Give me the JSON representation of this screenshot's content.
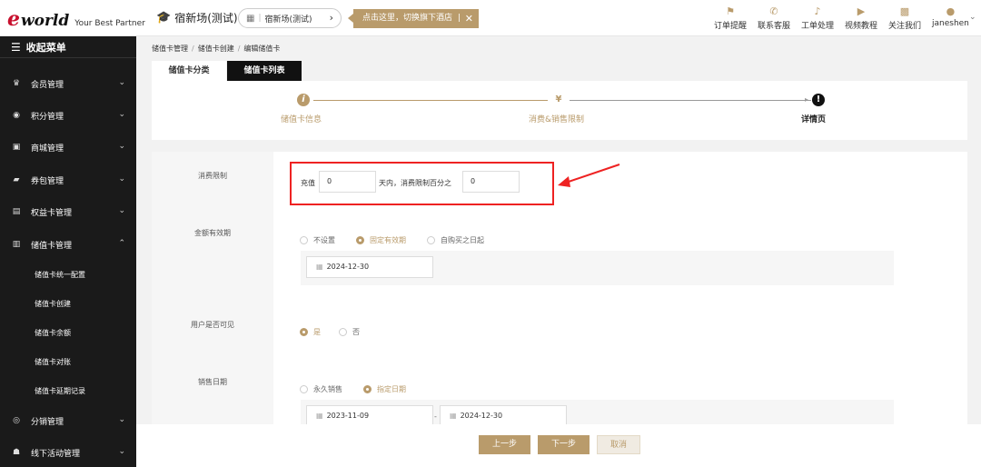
{
  "header": {
    "logo_e": "e",
    "logo_word": "world",
    "logo_tagline": "Your Best Partner",
    "hotel_name": "宿新场(测试)",
    "hotel_selector": "宿新场(测试)",
    "switch_tip": "点击这里，切换旗下酒店",
    "nav": [
      {
        "label": "订单提醒",
        "icon": "bell-ringing-icon"
      },
      {
        "label": "联系客服",
        "icon": "phone-icon"
      },
      {
        "label": "工单处理",
        "icon": "bell-icon"
      },
      {
        "label": "视频教程",
        "icon": "video-icon"
      },
      {
        "label": "关注我们",
        "icon": "qrcode-icon"
      },
      {
        "label": "janeshen",
        "icon": "user-icon"
      }
    ]
  },
  "sidebar": {
    "collapse_label": "收起菜单",
    "items": [
      {
        "label": "会员管理",
        "icon": "crown-icon"
      },
      {
        "label": "积分管理",
        "icon": "coins-icon"
      },
      {
        "label": "商城管理",
        "icon": "shop-icon"
      },
      {
        "label": "券包管理",
        "icon": "ticket-icon"
      },
      {
        "label": "权益卡管理",
        "icon": "card-icon"
      },
      {
        "label": "储值卡管理",
        "icon": "wallet-icon"
      }
    ],
    "subitems": [
      "储值卡统一配置",
      "储值卡创建",
      "储值卡余额",
      "储值卡对账",
      "储值卡延期记录"
    ],
    "items_after": [
      {
        "label": "分销管理",
        "icon": "share-icon"
      },
      {
        "label": "线下活动管理",
        "icon": "people-icon"
      }
    ]
  },
  "breadcrumb": [
    "储值卡管理",
    "储值卡创建",
    "编辑储值卡"
  ],
  "tabs": [
    "储值卡分类",
    "储值卡列表"
  ],
  "steps": [
    {
      "label": "储值卡信息",
      "icon": "i"
    },
    {
      "label": "消费&销售限制",
      "icon": "¥"
    },
    {
      "label": "详情页",
      "icon": "!"
    }
  ],
  "form": {
    "consume_limit": {
      "label": "消费限制",
      "prefix": "充值",
      "days_value": "0",
      "middle": "天内，消费限制百分之",
      "percent_value": "0"
    },
    "validity": {
      "label": "金额有效期",
      "options": [
        "不设置",
        "固定有效期",
        "自购买之日起"
      ],
      "selected": 1,
      "date": "2024-12-30"
    },
    "visible": {
      "label": "用户是否可见",
      "options": [
        "是",
        "否"
      ],
      "selected": 0
    },
    "sale_date": {
      "label": "销售日期",
      "options": [
        "永久销售",
        "指定日期"
      ],
      "selected": 1,
      "start": "2023-11-09",
      "dash": "-",
      "end": "2024-12-30"
    }
  },
  "buttons": {
    "prev": "上一步",
    "next": "下一步",
    "cancel": "取消"
  },
  "colors": {
    "accent": "#b99b6b",
    "highlight": "#e22222",
    "sidebar": "#1a1a1a"
  }
}
